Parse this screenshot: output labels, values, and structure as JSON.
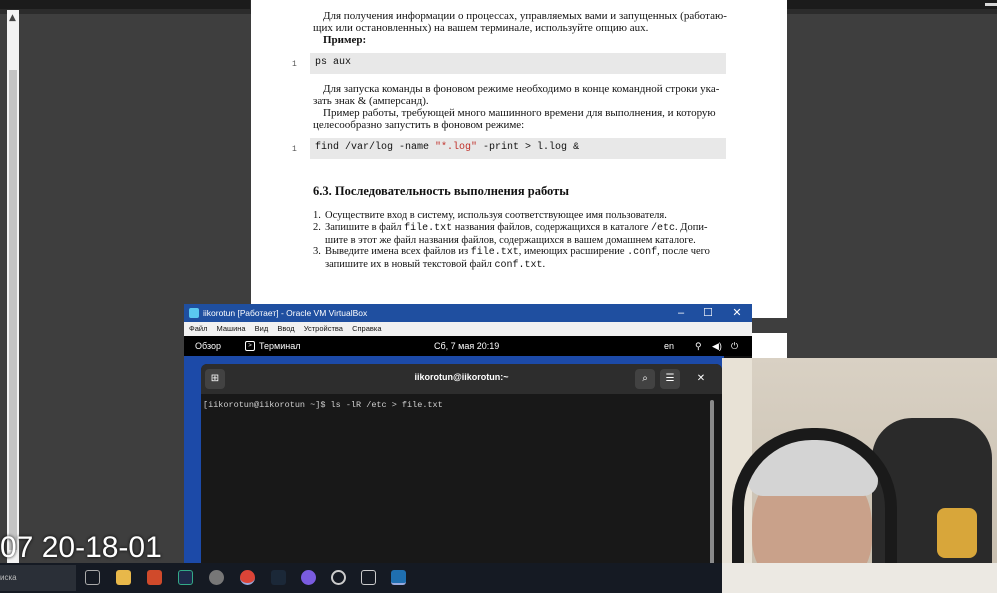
{
  "document": {
    "para1_line1": "Для получения информации о процессах, управляемых вами и запущенных (работаю-",
    "para1_line2": "щих или остановленных) на вашем терминале, используйте опцию aux.",
    "example_label": "Пример:",
    "code1": "ps aux",
    "code1_line": "1",
    "para2_line1": "Для запуска команды в фоновом режиме необходимо в конце командной строки ука-",
    "para2_line2": "зать знак & (амперсанд).",
    "para3_line1": "Пример работы, требующей много машинного времени для выполнения, и которую",
    "para3_line2": "целесообразно запустить в фоновом режиме:",
    "code2_pre": "find /var/log -name ",
    "code2_str": "\"*.log\"",
    "code2_post": " -print > l.log &",
    "code2_line": "1",
    "section_heading": "6.3.   Последовательность выполнения работы",
    "list": [
      {
        "num": "1.",
        "line1": "Осуществите вход в систему, используя соответствующее имя пользователя."
      },
      {
        "num": "2.",
        "l1a": "Запишите в файл ",
        "l1b": "file.txt",
        "l1c": " названия файлов, содержащихся в каталоге ",
        "l1d": "/etc",
        "l1e": ". Допи-",
        "line2": "шите в этот же файл названия файлов, содержащихся в вашем домашнем каталоге."
      },
      {
        "num": "3.",
        "l1a": "Выведите имена всех файлов из ",
        "l1b": "file.txt",
        "l1c": ", имеющих расширение ",
        "l1d": ".conf",
        "l1e": ", после чего",
        "l2a": "запишите их в новый текстовой файл ",
        "l2b": "conf.txt",
        "l2c": "."
      }
    ]
  },
  "virtualbox": {
    "title": "iikorotun [Работает] - Oracle VM VirtualBox",
    "menu": [
      "Файл",
      "Машина",
      "Вид",
      "Ввод",
      "Устройства",
      "Справка"
    ],
    "controls": {
      "minimize": "–",
      "maximize": "☐",
      "close": "✕"
    }
  },
  "gnome": {
    "overview": "Обзор",
    "app": "Терминал",
    "datetime": "Сб, 7 мая  20:19",
    "lang": "en"
  },
  "terminal": {
    "title": "iikorotun@iikorotun:~",
    "prompt_line": "[iikorotun@iikorotun ~]$ ls -lR /etc > file.txt"
  },
  "overlay": {
    "clock": "07 20-18-01",
    "search": "иска"
  },
  "icons": [
    "new-tab-icon",
    "search-icon",
    "hamburger-menu-icon",
    "close-icon",
    "network-icon",
    "volume-icon",
    "power-icon",
    "terminal-icon"
  ]
}
